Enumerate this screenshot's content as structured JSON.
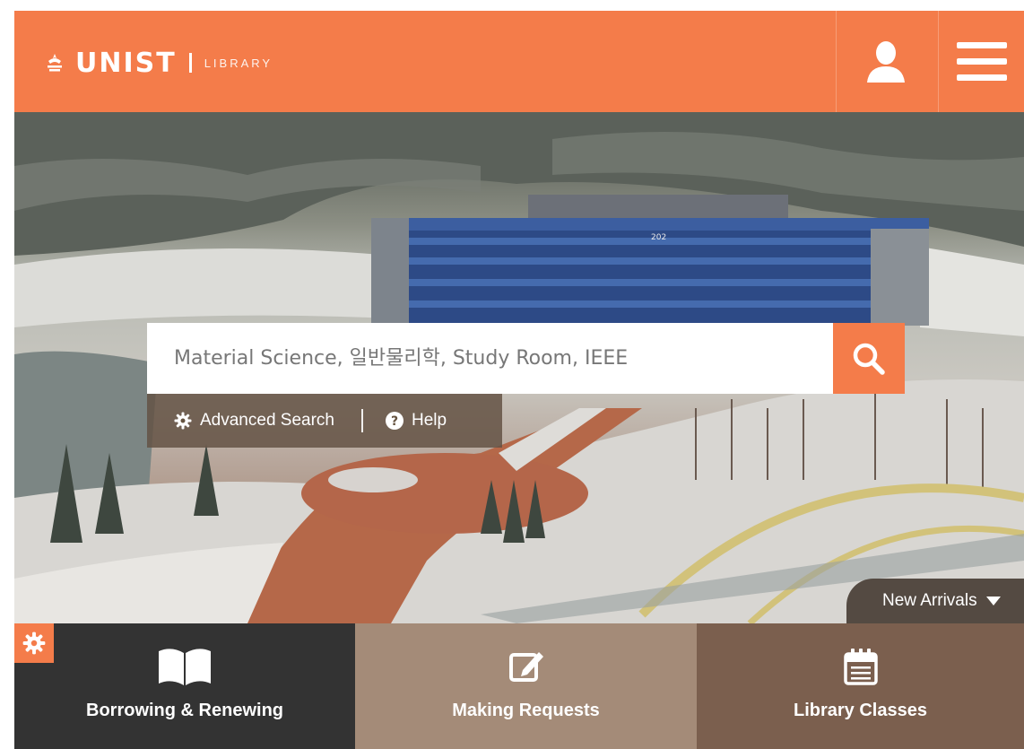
{
  "header": {
    "logo_text": "UNIST",
    "logo_subtext": "LIBRARY",
    "brand_color": "#f47c4a",
    "user_button_icon": "user-icon",
    "menu_button_icon": "hamburger-menu-icon"
  },
  "search": {
    "placeholder": "Material Science, 일반물리학, Study Room, IEEE",
    "value": "",
    "button_icon": "search-icon",
    "advanced_label": "Advanced Search",
    "help_label": "Help"
  },
  "hero": {
    "building_label": "202",
    "new_arrivals_label": "New Arrivals"
  },
  "tiles": [
    {
      "label": "Borrowing & Renewing",
      "icon": "open-book-icon",
      "color": "#333333"
    },
    {
      "label": "Making Requests",
      "icon": "edit-note-icon",
      "color": "#a48b78"
    },
    {
      "label": "Library Classes",
      "icon": "calendar-icon",
      "color": "#7b5f4e"
    }
  ],
  "corner_settings_icon": "gear-icon"
}
